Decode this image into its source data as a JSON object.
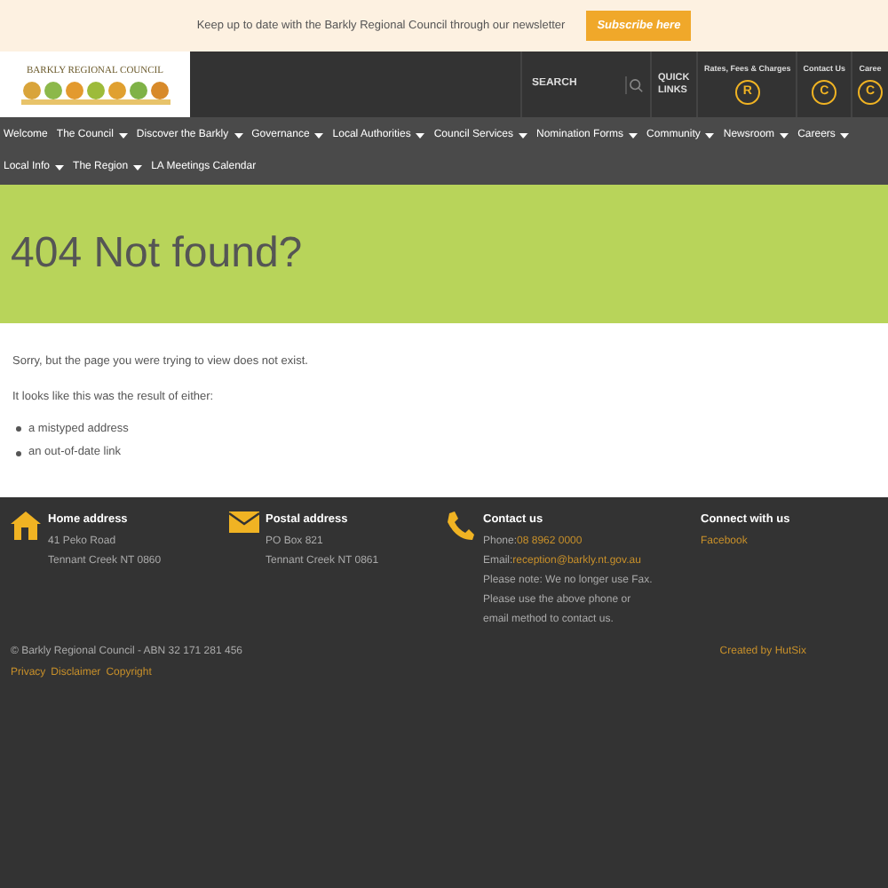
{
  "banner": {
    "text": "Keep up to date with the Barkly Regional Council through our newsletter",
    "button": "Subscribe here"
  },
  "header": {
    "logo_text": "BARKLY REGIONAL COUNCIL",
    "search": {
      "placeholder": "SEARCH"
    },
    "quick_links": "QUICK LINKS",
    "links": [
      {
        "label": "Rates, Fees & Charges",
        "letter": "R"
      },
      {
        "label": "Contact Us",
        "letter": "C"
      },
      {
        "label": "Caree",
        "letter": "C"
      }
    ]
  },
  "nav": {
    "rows": [
      [
        {
          "label": "Welcome",
          "has_menu": false
        },
        {
          "label": "The Council",
          "has_menu": true
        },
        {
          "label": "Discover the Barkly",
          "has_menu": true
        },
        {
          "label": "Governance",
          "has_menu": true
        },
        {
          "label": "Local Authorities",
          "has_menu": true
        },
        {
          "label": "Council Services",
          "has_menu": true
        },
        {
          "label": "Nomination Forms",
          "has_menu": true
        },
        {
          "label": "Community",
          "has_menu": true
        },
        {
          "label": "Newsroom",
          "has_menu": true
        },
        {
          "label": "Careers",
          "has_menu": true
        }
      ],
      [
        {
          "label": "Local Info",
          "has_menu": true
        },
        {
          "label": "The Region",
          "has_menu": true
        },
        {
          "label": "LA Meetings Calendar",
          "has_menu": false
        }
      ]
    ]
  },
  "hero": {
    "title": "404 Not found?"
  },
  "content": {
    "paragraphs": [
      "Sorry, but the page you were trying to view does not exist.",
      "It looks like this was the result of either:"
    ],
    "bullets": [
      "a mistyped address",
      "an out-of-date link"
    ]
  },
  "footer": {
    "columns": [
      {
        "kind": "home",
        "title": "Home address",
        "lines": [
          {
            "text": "41 Peko Road"
          },
          {
            "text": "Tennant Creek NT 0860"
          }
        ]
      },
      {
        "kind": "mail",
        "title": "Postal address",
        "lines": [
          {
            "text": "PO Box 821"
          },
          {
            "text": "Tennant Creek NT 0861"
          }
        ]
      },
      {
        "kind": "phone",
        "title": "Contact us",
        "lines": [
          {
            "text": "Phone: ",
            "link": "08 8962 0000"
          },
          {
            "text": "Email: ",
            "link": "reception@barkly.nt.gov.au"
          },
          {
            "text": "Please note: We no longer use Fax."
          },
          {
            "text": "Please use the above phone or"
          },
          {
            "text": "email method to contact us."
          }
        ]
      },
      {
        "kind": "social",
        "title": "Connect with us",
        "lines": [
          {
            "link": "Facebook"
          }
        ]
      }
    ],
    "copyright": "© Barkly Regional Council - ABN 32 171 281 456",
    "legal_links": [
      "Privacy",
      "Disclaimer",
      "Copyright"
    ],
    "credit": "Created by HutSix"
  }
}
